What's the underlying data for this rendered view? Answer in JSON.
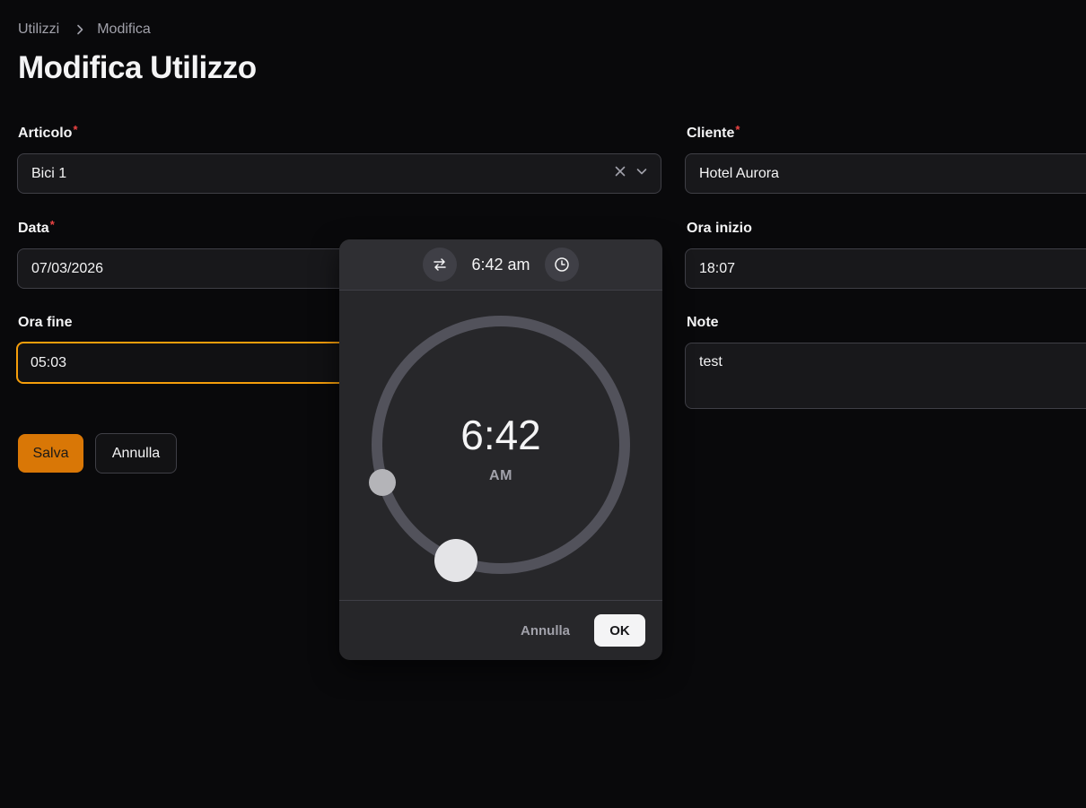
{
  "breadcrumb": {
    "parent": "Utilizzi",
    "current": "Modifica"
  },
  "page_title": "Modifica Utilizzo",
  "form": {
    "articolo": {
      "label": "Articolo",
      "required_mark": "*",
      "value": "Bici 1"
    },
    "cliente": {
      "label": "Cliente",
      "required_mark": "*",
      "value": "Hotel Aurora"
    },
    "data": {
      "label": "Data",
      "required_mark": "*",
      "value": "07/03/2026"
    },
    "ora_inizio": {
      "label": "Ora inizio",
      "value": "18:07"
    },
    "ora_fine": {
      "label": "Ora fine",
      "value": "05:03"
    },
    "note": {
      "label": "Note",
      "value": "test"
    }
  },
  "actions": {
    "save_label": "Salva",
    "cancel_label": "Annulla"
  },
  "time_picker": {
    "header_time": "6:42 am",
    "dial_time": "6:42",
    "dial_period": "AM",
    "cancel_label": "Annulla",
    "ok_label": "OK"
  },
  "colors": {
    "accent": "#d97706",
    "focus_border": "#f59e0b",
    "required": "#ef4444",
    "background": "#09090b"
  },
  "icons": {
    "breadcrumb_separator": "chevron-right-icon",
    "select_clear": "close-icon",
    "select_open": "chevron-down-icon",
    "picker_switch": "swap-arrows-icon",
    "picker_mode": "clock-icon"
  }
}
